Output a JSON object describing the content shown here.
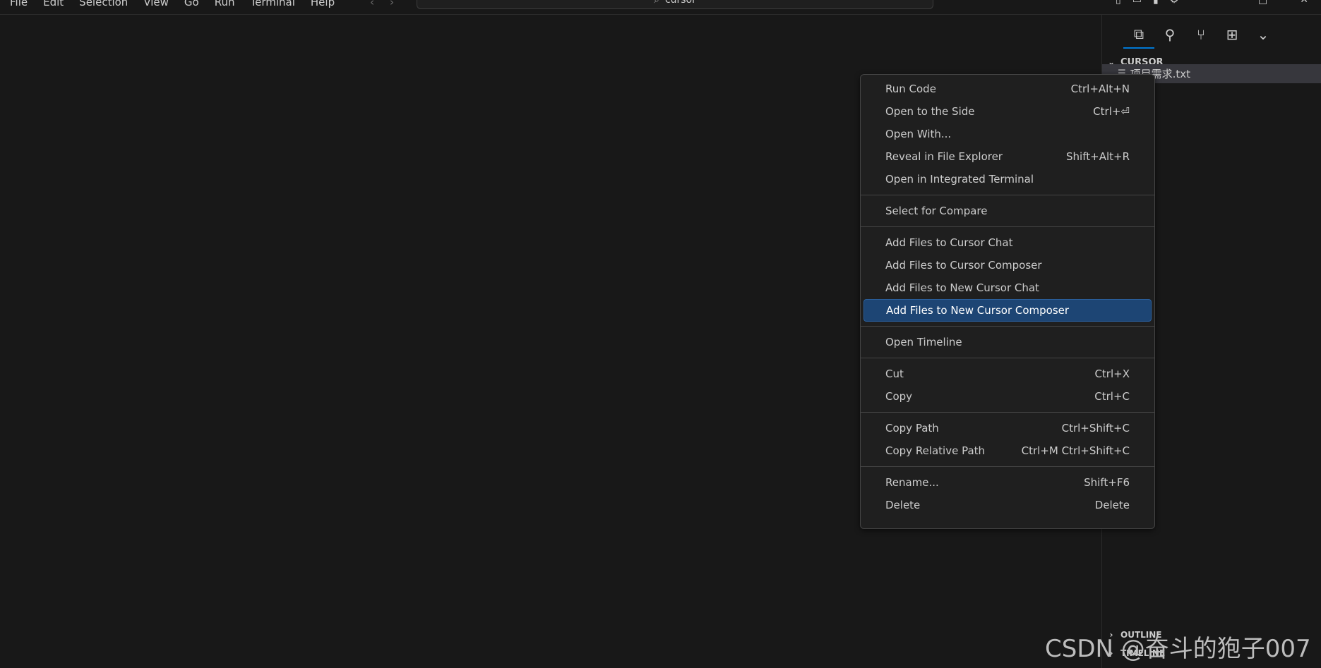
{
  "menubar": {
    "items": [
      "File",
      "Edit",
      "Selection",
      "View",
      "Go",
      "Run",
      "Terminal",
      "Help"
    ]
  },
  "nav": {
    "back": "‹",
    "forward": "›"
  },
  "command_center": {
    "text": "cursor",
    "icon": "search-icon"
  },
  "sidebar": {
    "section_title": "CURSOR",
    "file": {
      "name": "项目需求.txt",
      "icon": "text-file-icon"
    },
    "outline_title": "OUTLINE",
    "timeline_title": "TIMELINE"
  },
  "context_menu": {
    "groups": [
      [
        {
          "label": "Run Code",
          "shortcut": "Ctrl+Alt+N"
        },
        {
          "label": "Open to the Side",
          "shortcut": "Ctrl+⏎"
        },
        {
          "label": "Open With...",
          "shortcut": ""
        },
        {
          "label": "Reveal in File Explorer",
          "shortcut": "Shift+Alt+R"
        },
        {
          "label": "Open in Integrated Terminal",
          "shortcut": ""
        }
      ],
      [
        {
          "label": "Select for Compare",
          "shortcut": ""
        }
      ],
      [
        {
          "label": "Add Files to Cursor Chat",
          "shortcut": ""
        },
        {
          "label": "Add Files to Cursor Composer",
          "shortcut": ""
        },
        {
          "label": "Add Files to New Cursor Chat",
          "shortcut": ""
        },
        {
          "label": "Add Files to New Cursor Composer",
          "shortcut": "",
          "selected": true
        }
      ],
      [
        {
          "label": "Open Timeline",
          "shortcut": ""
        }
      ],
      [
        {
          "label": "Cut",
          "shortcut": "Ctrl+X"
        },
        {
          "label": "Copy",
          "shortcut": "Ctrl+C"
        }
      ],
      [
        {
          "label": "Copy Path",
          "shortcut": "Ctrl+Shift+C"
        },
        {
          "label": "Copy Relative Path",
          "shortcut": "Ctrl+M Ctrl+Shift+C"
        }
      ],
      [
        {
          "label": "Rename...",
          "shortcut": "Shift+F6"
        },
        {
          "label": "Delete",
          "shortcut": "Delete"
        }
      ]
    ]
  },
  "watermark": "CSDN @奋斗的狍子007",
  "colors": {
    "background": "#181818",
    "menu_background": "#1f1f1f",
    "selected": "#1d4574",
    "accent": "#0078d4"
  }
}
